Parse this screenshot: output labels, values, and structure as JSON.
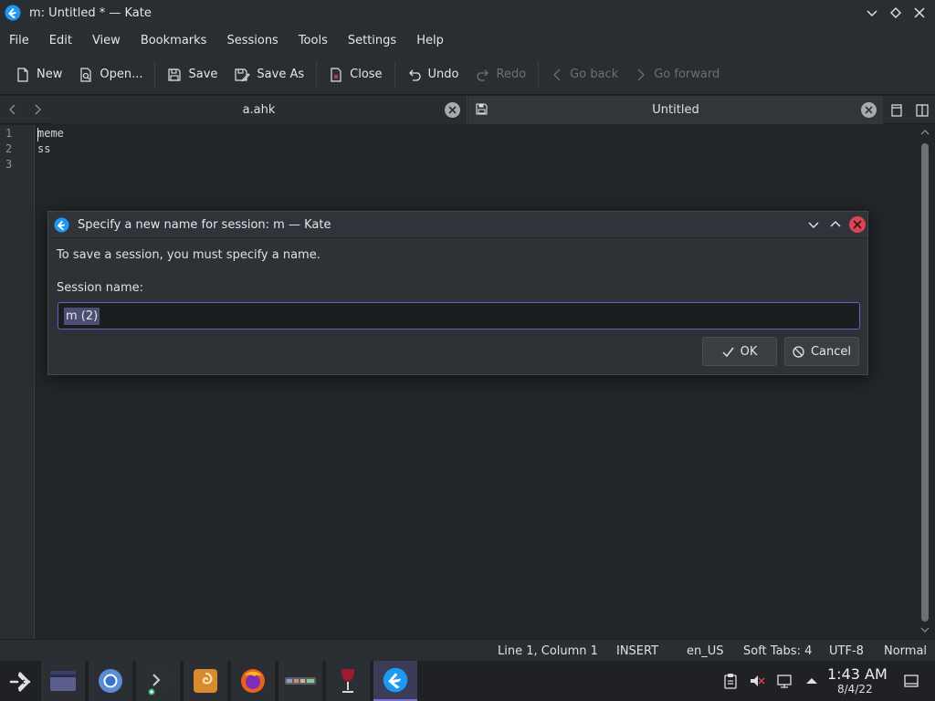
{
  "window": {
    "title": "m: Untitled * — Kate"
  },
  "menu": [
    "File",
    "Edit",
    "View",
    "Bookmarks",
    "Sessions",
    "Tools",
    "Settings",
    "Help"
  ],
  "toolbar": {
    "new": "New",
    "open": "Open...",
    "save": "Save",
    "save_as": "Save As",
    "close": "Close",
    "undo": "Undo",
    "redo": "Redo",
    "go_back": "Go back",
    "go_forward": "Go forward"
  },
  "tabs": {
    "tab1": "a.ahk",
    "tab2": "Untitled"
  },
  "editor": {
    "line_numbers": [
      "1",
      "2",
      "3"
    ],
    "lines": [
      "meme",
      "ss",
      ""
    ]
  },
  "dialog": {
    "title": "Specify a new name for session: m — Kate",
    "message": "To save a session, you must specify a name.",
    "label": "Session name:",
    "value": "m (2)",
    "ok": "OK",
    "cancel": "Cancel"
  },
  "status": {
    "position": "Line 1, Column 1",
    "mode": "INSERT",
    "language": "en_US",
    "tabs": "Soft Tabs: 4",
    "encoding": "UTF-8",
    "highlight": "Normal"
  },
  "taskbar": {
    "time": "1:43 AM",
    "date": "8/4/22"
  },
  "colors": {
    "accent": "#7d6ed6",
    "close_red": "#da4453",
    "kate_blue": "#1d99f3"
  }
}
